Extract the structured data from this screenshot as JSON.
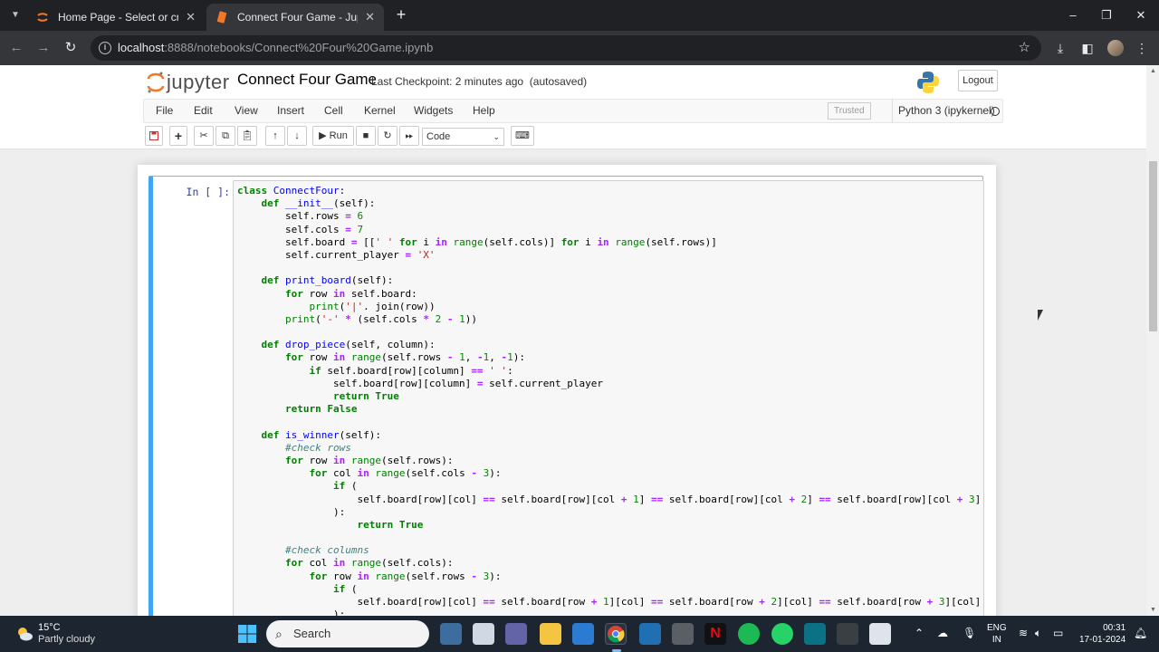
{
  "browser": {
    "tabs": [
      {
        "title": "Home Page - Select or create a",
        "active": false
      },
      {
        "title": "Connect Four Game - Jupyter N",
        "active": true
      }
    ],
    "url_host": "localhost",
    "url_path": ":8888/notebooks/Connect%20Four%20Game.ipynb"
  },
  "jupyter": {
    "logo_text": "jupyter",
    "notebook_name": "Connect Four Game",
    "checkpoint": "Last Checkpoint: 2 minutes ago",
    "autosave": "(autosaved)",
    "logout": "Logout",
    "menu": [
      "File",
      "Edit",
      "View",
      "Insert",
      "Cell",
      "Kernel",
      "Widgets",
      "Help"
    ],
    "trusted": "Trusted",
    "kernel": "Python 3 (ipykernel)",
    "toolbar": {
      "run": "Run",
      "cell_type": "Code"
    }
  },
  "cell": {
    "prompt": "In [ ]:"
  },
  "taskbar": {
    "weather_temp": "15°C",
    "weather_desc": "Partly cloudy",
    "search": "Search",
    "lang_line1": "ENG",
    "lang_line2": "IN",
    "time": "00:31",
    "date": "17-01-2024"
  },
  "colors": {
    "cell_accent": "#42a5f5",
    "keyword": "#008000",
    "function_name": "#0000ff",
    "string": "#ba2121",
    "operator": "#aa22ff",
    "comment": "#408080"
  }
}
